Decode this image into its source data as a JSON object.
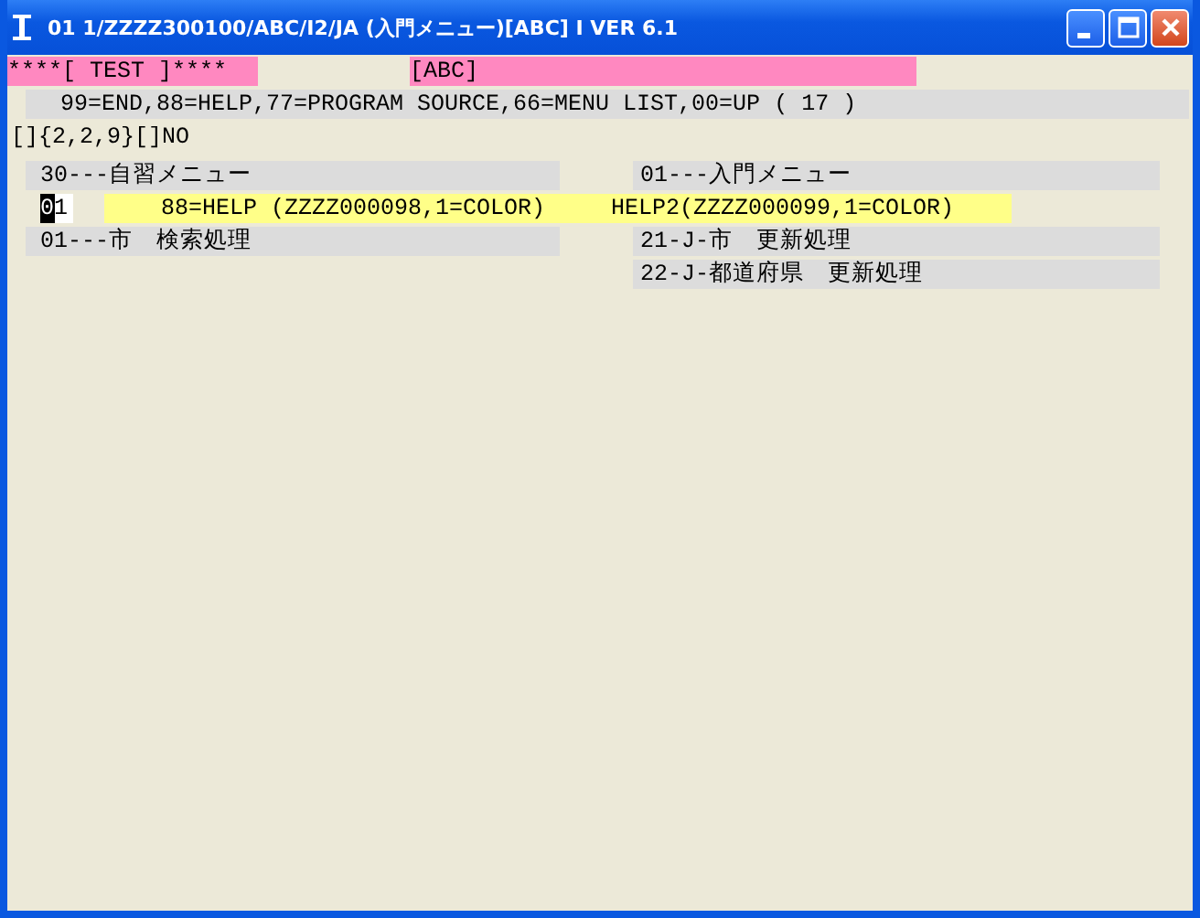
{
  "window": {
    "title": "01 1/ZZZZ300100/ABC/I2/JA (入門メニュー)[ABC] I VER 6.1"
  },
  "header": {
    "left": "****[ TEST ]****",
    "right": "[ABC]"
  },
  "command_line": "99=END,88=HELP,77=PROGRAM SOURCE,66=MENU LIST,00=UP ( 17 )",
  "status_line": "[]{2,2,9}[]NO",
  "menu_titles": {
    "left": "30---自習メニュー",
    "right": "01---入門メニュー"
  },
  "input": {
    "value": "01"
  },
  "help": {
    "left": "88=HELP (ZZZZ000098,1=COLOR)",
    "right": "HELP2(ZZZZ000099,1=COLOR)"
  },
  "items_left": [
    "01---市　検索処理"
  ],
  "items_right": [
    "21-J-市　更新処理",
    "22-J-都道府県　更新処理"
  ]
}
